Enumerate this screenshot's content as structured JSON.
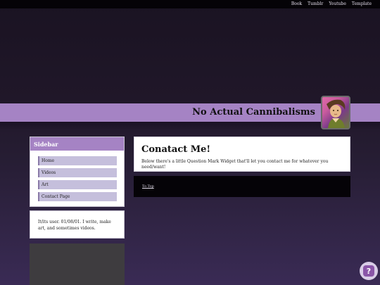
{
  "topnav": {
    "items": [
      {
        "label": "Book"
      },
      {
        "label": "Tumblr"
      },
      {
        "label": "Youtube"
      },
      {
        "label": "Template"
      }
    ]
  },
  "header": {
    "title": "No Actual Cannibalisms",
    "accent_color": "#a583c4"
  },
  "sidebar": {
    "title": "Sidebar",
    "items": [
      {
        "label": "Home"
      },
      {
        "label": "Videos"
      },
      {
        "label": "Art"
      },
      {
        "label": "Contact Page"
      }
    ]
  },
  "bio": {
    "text": "It/its user. 01/08/01. I write, make art, and sometimes videos."
  },
  "main": {
    "heading": "Conatact Me!",
    "body": "Below there's a little Question Mark Widget that'll let you contact me for whatever you need/want!",
    "to_top_label": "To Top"
  },
  "widget": {
    "icon": "question-mark-icon",
    "glyph": "?"
  }
}
